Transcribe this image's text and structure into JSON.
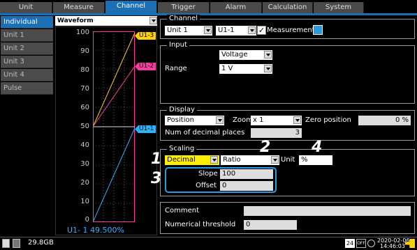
{
  "tabs": [
    "Unit",
    "Measure",
    "Channel",
    "Trigger",
    "Alarm",
    "Calculation",
    "System"
  ],
  "active_tab": "Channel",
  "nav": [
    "Individual",
    "Unit 1",
    "Unit 2",
    "Unit 3",
    "Unit 4",
    "Pulse"
  ],
  "waveform": {
    "selector": "Waveform",
    "yticks": [
      "100",
      "90",
      "80",
      "70",
      "60",
      "50",
      "40",
      "30",
      "20",
      "10",
      "0"
    ],
    "ch_labels": [
      {
        "text": "U1-3",
        "color": "#ffd200"
      },
      {
        "text": "U1-2",
        "color": "#ff3aa0"
      },
      {
        "text": "U1-1",
        "color": "#28b4ff"
      }
    ],
    "readout": "U1- 1 49.500%"
  },
  "channel": {
    "title": "Channel",
    "unit": "Unit 1",
    "ch": "U1-1",
    "measurement_label": "Measurement",
    "measurement_checked": true,
    "color": "#2a9be0"
  },
  "input": {
    "title": "Input",
    "type": "Voltage",
    "range_label": "Range",
    "range": "1 V"
  },
  "display": {
    "title": "Display",
    "position_select": "Position",
    "zoom_label": "Zoom",
    "zoom": "x 1",
    "zero_label": "Zero position",
    "zero_value": "0 %",
    "decimal_label": "Num of decimal places",
    "decimal_value": "3"
  },
  "scaling": {
    "title": "Scaling",
    "notation": "Decimal",
    "method": "Ratio",
    "unit_label": "Unit",
    "unit_value": "%",
    "slope_label": "Slope",
    "slope_value": "100",
    "offset_label": "Offset",
    "offset_value": "0",
    "callouts": [
      "1",
      "2",
      "3",
      "4"
    ]
  },
  "misc": {
    "comment_label": "Comment",
    "comment_value": "",
    "threshold_label": "Numerical threshold",
    "threshold_value": "0"
  },
  "status": {
    "storage": "29.8GB",
    "badge": "24",
    "off_label": "OFF",
    "date": "2020-02-06",
    "time": "14:46:03"
  }
}
